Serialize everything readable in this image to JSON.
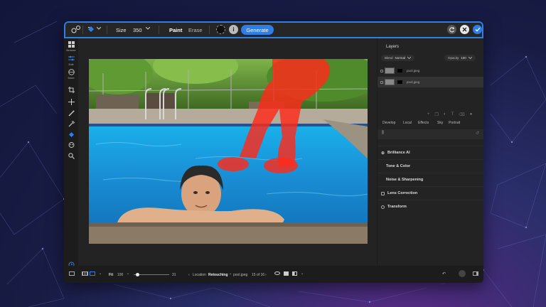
{
  "colors": {
    "accent": "#2f7ee6",
    "background": "#181c44",
    "window": "#1f1f1f",
    "mask": "#ff2a1a"
  },
  "toolbar": {
    "size_label": "Size",
    "size_value": "350",
    "paint_label": "Paint",
    "erase_label": "Erase",
    "info_icon": "i",
    "generate_label": "Generate"
  },
  "rail": [
    {
      "icon": "browse-grid-icon",
      "label": "Browse"
    },
    {
      "icon": "edit-sliders-icon",
      "label": "Edit"
    },
    {
      "icon": "more-icon",
      "label": "More"
    }
  ],
  "layers": {
    "title": "Layers",
    "blend_label": "Blend",
    "blend_value": "Normal",
    "opacity_label": "Opacity",
    "opacity_value": "100",
    "items": [
      {
        "name": "pool.jpeg"
      },
      {
        "name": "pool.jpeg"
      }
    ]
  },
  "tabs": [
    "Develop",
    "Local",
    "Effects",
    "Sky",
    "Portrait"
  ],
  "sections": [
    {
      "label": "Brilliance AI",
      "checkbox": true
    },
    {
      "label": "Tone & Color",
      "checkbox": false
    },
    {
      "label": "Noise & Sharpening",
      "checkbox": false
    },
    {
      "label": "Lens Correction",
      "checkbox": true
    },
    {
      "label": "Transform",
      "checkbox": true
    }
  ],
  "bottom": {
    "fit_label": "Fit",
    "zoom_value": "100",
    "slider_value": "31",
    "slider_fraction": 0.05,
    "location_label": "Location",
    "location_value": "Retouching",
    "filename": "pool.jpeg",
    "counter": "15 of 16"
  }
}
